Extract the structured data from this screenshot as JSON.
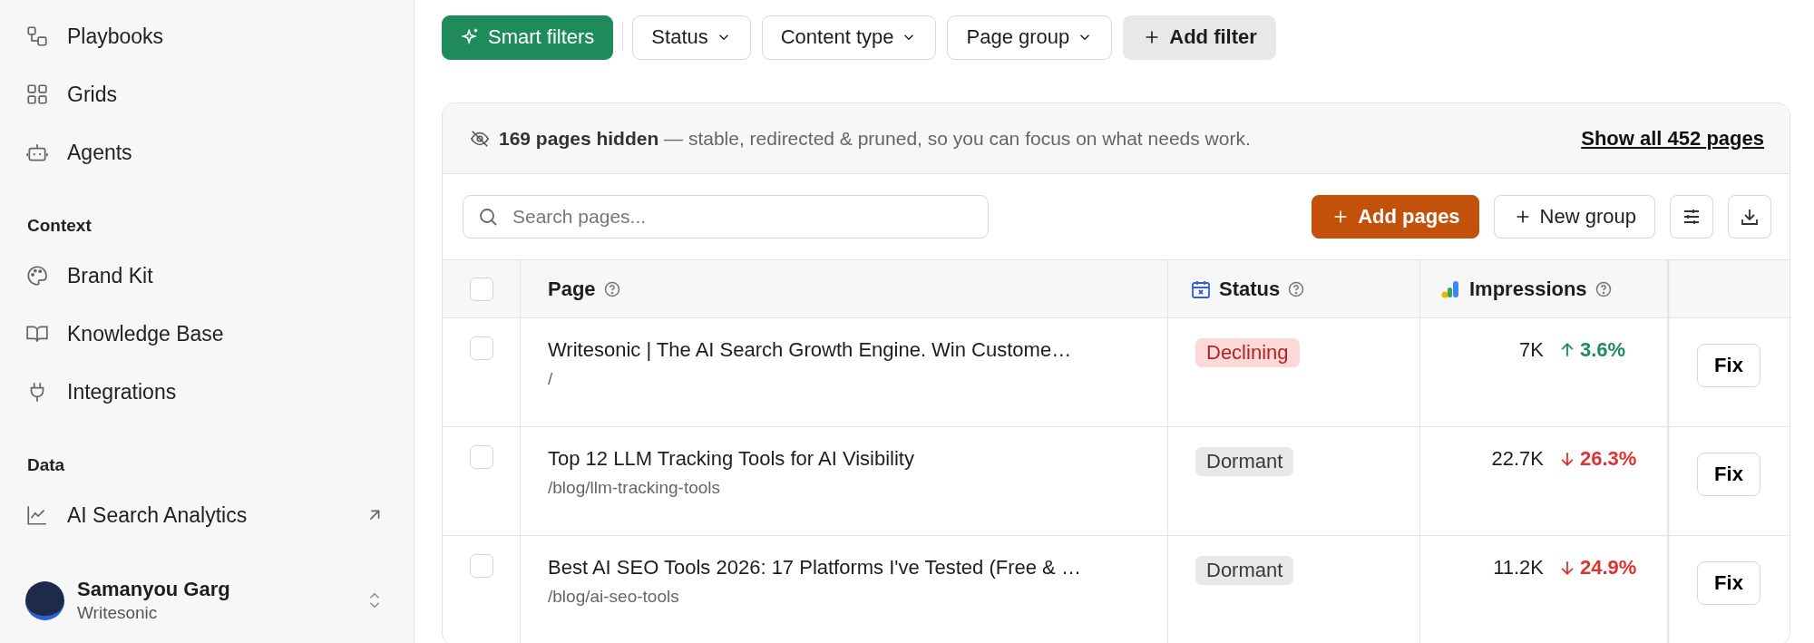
{
  "sidebar": {
    "sections": [
      {
        "items": [
          {
            "label": "Playbooks",
            "external": false
          },
          {
            "label": "Grids",
            "external": false
          },
          {
            "label": "Agents",
            "external": false
          }
        ]
      },
      {
        "title": "Context",
        "items": [
          {
            "label": "Brand Kit",
            "external": false
          },
          {
            "label": "Knowledge Base",
            "external": false
          },
          {
            "label": "Integrations",
            "external": false
          }
        ]
      },
      {
        "title": "Data",
        "items": [
          {
            "label": "AI Search Analytics",
            "external": true
          }
        ]
      }
    ],
    "user": {
      "name": "Samanyou Garg",
      "org": "Writesonic"
    }
  },
  "filters": [
    {
      "label": "Smart filters",
      "kind": "smart"
    },
    {
      "label": "Status",
      "kind": "dropdown"
    },
    {
      "label": "Content type",
      "kind": "dropdown"
    },
    {
      "label": "Page group",
      "kind": "dropdown"
    },
    {
      "label": "Add filter",
      "kind": "add"
    }
  ],
  "banner": {
    "text": "**169 pages hidden** — stable, redirected & pruned, so you can focus on what needs work.",
    "link": "Show all 452 pages"
  },
  "toolbar": {
    "search": {
      "placeholder": "Search pages..."
    },
    "buttons": [
      {
        "label": "Add pages",
        "kind": "primary"
      },
      {
        "label": "New group",
        "kind": "secondary"
      }
    ]
  },
  "table": {
    "header_checked": false,
    "columns": [
      {
        "label": "Page"
      },
      {
        "label": "Status"
      },
      {
        "label": "Impressions"
      }
    ],
    "rows": [
      {
        "checked": false,
        "title": "Writesonic | The AI Search Growth Engine. Win Custome…",
        "path": "/",
        "status": {
          "label": "Declining",
          "kind": "declining"
        },
        "impressions": "7K",
        "change": "3.6%",
        "kind": "up",
        "action": "Fix"
      },
      {
        "checked": false,
        "title": "Top 12 LLM Tracking Tools for AI Visibility",
        "path": "/blog/llm-tracking-tools",
        "status": {
          "label": "Dormant",
          "kind": "dormant"
        },
        "impressions": "22.7K",
        "change": "26.3%",
        "kind": "down",
        "action": "Fix"
      },
      {
        "checked": false,
        "title": "Best AI SEO Tools 2026: 17 Platforms I've Tested (Free & …",
        "path": "/blog/ai-seo-tools",
        "status": {
          "label": "Dormant",
          "kind": "dormant"
        },
        "impressions": "11.2K",
        "change": "24.9%",
        "kind": "down",
        "action": "Fix"
      }
    ]
  }
}
